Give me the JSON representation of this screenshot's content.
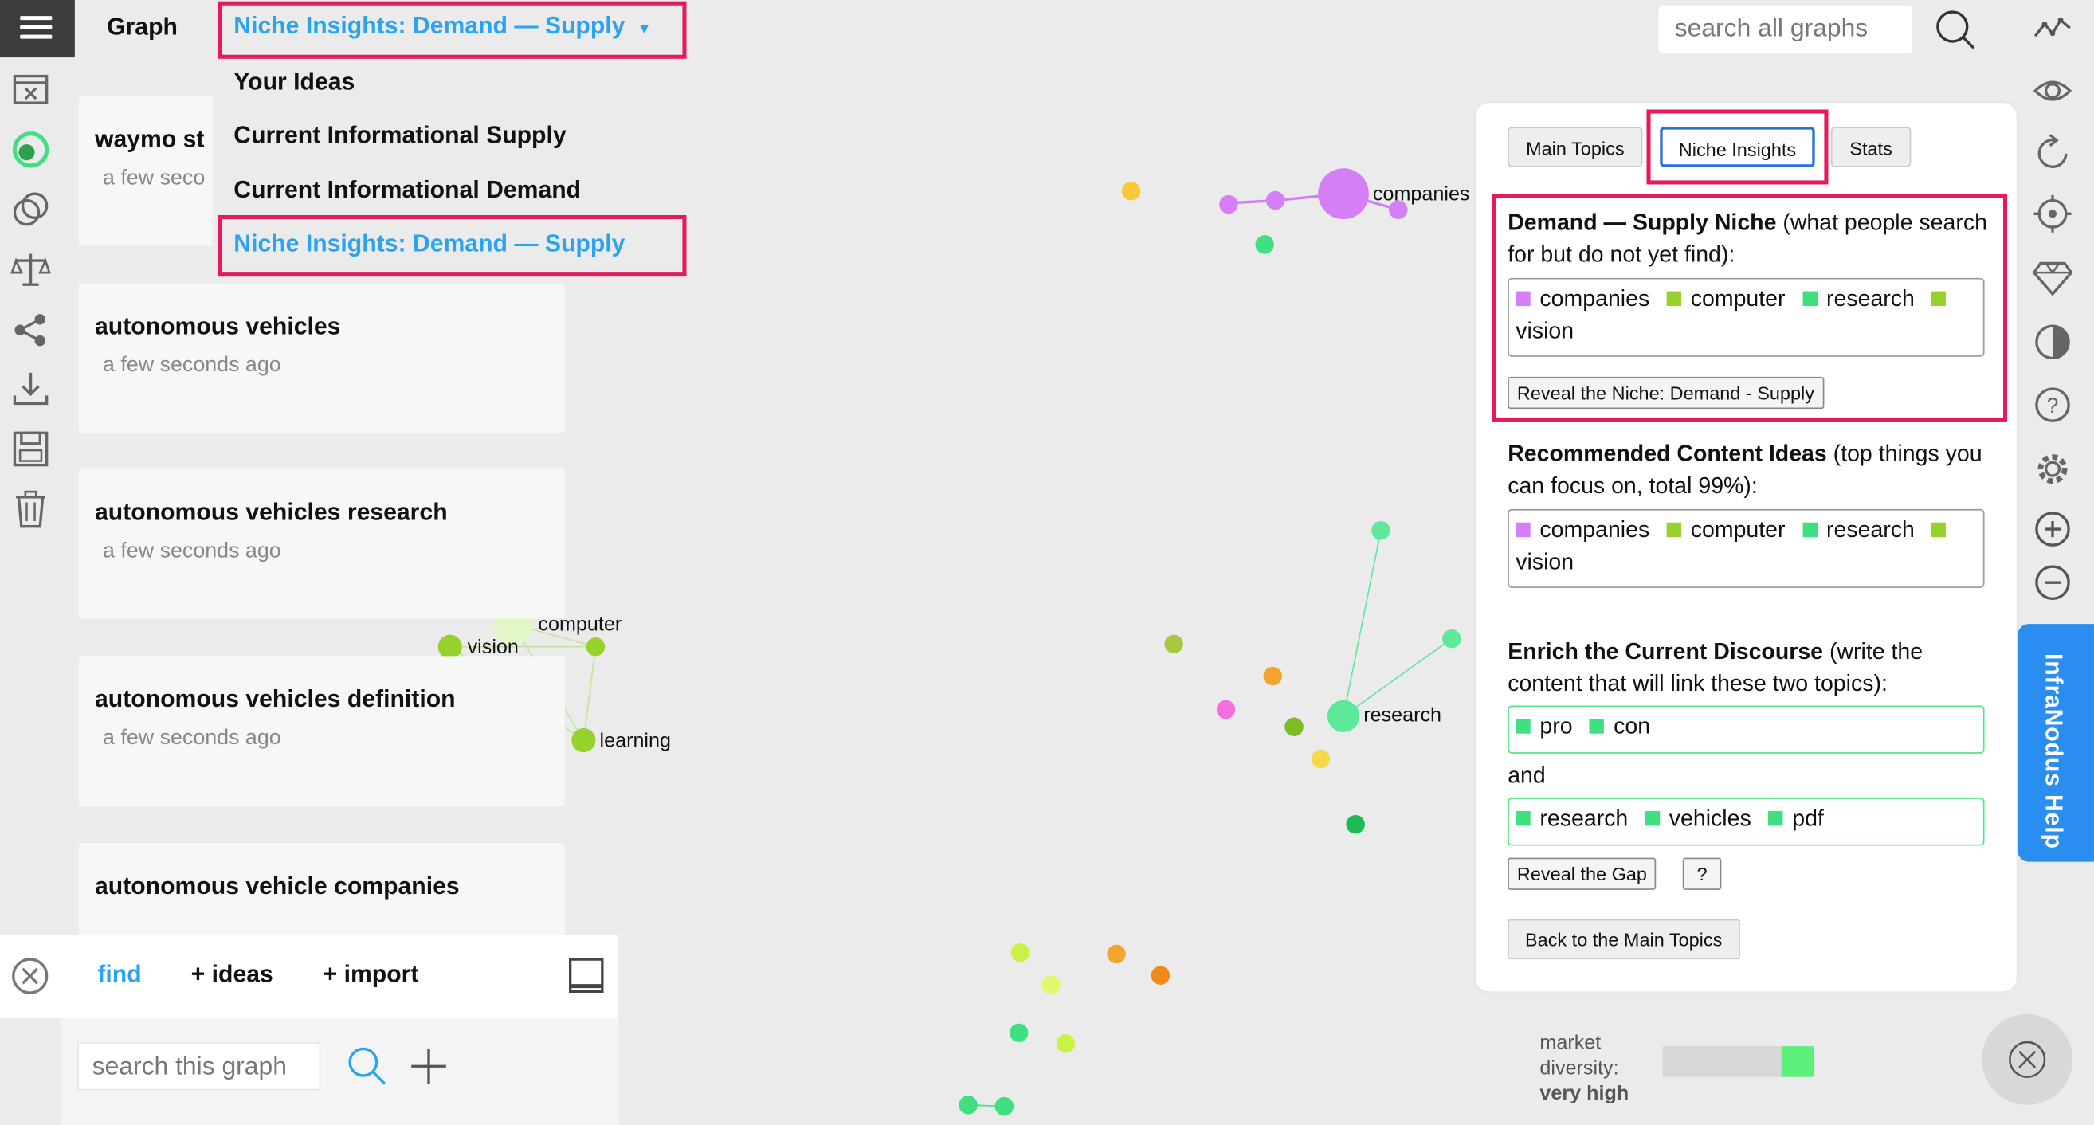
{
  "header": {
    "graph_label": "Graph",
    "selected_view": "Niche Insights: Demand — Supply",
    "search_placeholder": "search all graphs"
  },
  "view_menu": {
    "items": [
      "Your Ideas",
      "Current Informational Supply",
      "Current Informational Demand",
      "Niche Insights: Demand — Supply"
    ]
  },
  "graphs": [
    {
      "title": "waymo st",
      "time": "a few seco"
    },
    {
      "title": "autonomous vehicles",
      "time": "a few seconds ago"
    },
    {
      "title": "autonomous vehicles research",
      "time": "a few seconds ago"
    },
    {
      "title": "autonomous vehicles definition",
      "time": "a few seconds ago"
    },
    {
      "title": "autonomous vehicle companies",
      "time": ""
    }
  ],
  "graph_labels": {
    "companies": "companies",
    "computer": "computer",
    "vision": "vision",
    "learning": "learning",
    "research": "research"
  },
  "bottom": {
    "find": "find",
    "ideas": "+ ideas",
    "import": "+ import",
    "search_placeholder": "search this graph"
  },
  "panel": {
    "tabs": [
      "Main Topics",
      "Niche Insights",
      "Stats"
    ],
    "niche": {
      "heading": "Demand — Supply Niche",
      "subtitle": " (what people search for but do not yet find):",
      "tags": [
        {
          "word": "companies",
          "color": "#d47ff5"
        },
        {
          "word": "computer",
          "color": "#97d12c"
        },
        {
          "word": "research",
          "color": "#3fe080"
        },
        {
          "word": "vision",
          "color": "#97d12c"
        }
      ],
      "button": "Reveal the Niche: Demand - Supply"
    },
    "recommended": {
      "heading": "Recommended Content Ideas",
      "subtitle": " (top things you can focus on, total 99%):",
      "tags": [
        {
          "word": "companies",
          "color": "#d47ff5"
        },
        {
          "word": "computer",
          "color": "#97d12c"
        },
        {
          "word": "research",
          "color": "#3fe080"
        },
        {
          "word": "vision",
          "color": "#97d12c"
        }
      ]
    },
    "enrich": {
      "heading": "Enrich the Current Discourse",
      "subtitle": " (write the content that will link these two topics):",
      "group_a": [
        {
          "word": "pro",
          "color": "#3fe080"
        },
        {
          "word": "con",
          "color": "#3fe080"
        }
      ],
      "and_label": "and",
      "group_b": [
        {
          "word": "research",
          "color": "#3fe080"
        },
        {
          "word": "vehicles",
          "color": "#3fe080"
        },
        {
          "word": "pdf",
          "color": "#3fe080"
        }
      ],
      "reveal_gap": "Reveal the Gap",
      "help": "?",
      "back": "Back to the Main Topics"
    }
  },
  "diversity": {
    "label_1": "market",
    "label_2": "diversity:",
    "value": "very high",
    "level": 0.9
  },
  "help_tab": "InfraNodus Help",
  "colors": {
    "accent": "#2aa3f2",
    "highlight": "#e8195a",
    "help_tab": "#2a8ef0"
  }
}
